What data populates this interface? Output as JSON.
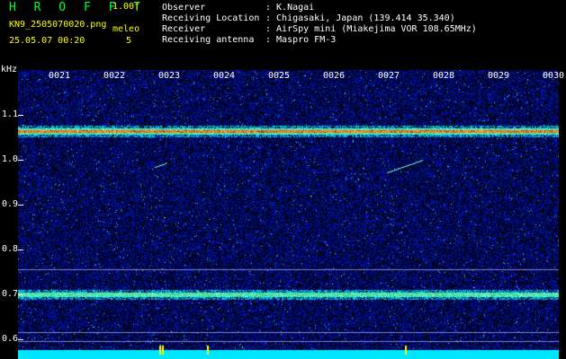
{
  "header": {
    "brand": "H R O F F T",
    "version": "1.00f",
    "filename": "KN9_2505070020.png",
    "mode": "meleo",
    "datetime": "25.05.07 00:20",
    "number": "5",
    "observer_label": "Observer",
    "observer": ": K.Nagai",
    "location_label": "Receiving Location",
    "location": ": Chigasaki, Japan (139.414 35.340)",
    "receiver_label": "Receiver",
    "receiver": ": AirSpy mini (Miakejima VOR 108.65MHz)",
    "antenna_label": "Receiving antenna",
    "antenna": ": Maspro FM-3"
  },
  "axis": {
    "unit": "kHz",
    "y_ticks": [
      "1.1",
      "1.0",
      "0.9",
      "0.8",
      "0.7",
      "0.6"
    ],
    "x_ticks": [
      "0021",
      "0022",
      "0023",
      "0024",
      "0025",
      "0026",
      "0027",
      "0028",
      "0029",
      "0030"
    ]
  },
  "colors": {
    "label_yellow": "#ffff00",
    "brand_green": "#00ff33",
    "background": "#000000",
    "noise_blue": "#1a30c0",
    "signal_cyan": "#00e0ff"
  }
}
